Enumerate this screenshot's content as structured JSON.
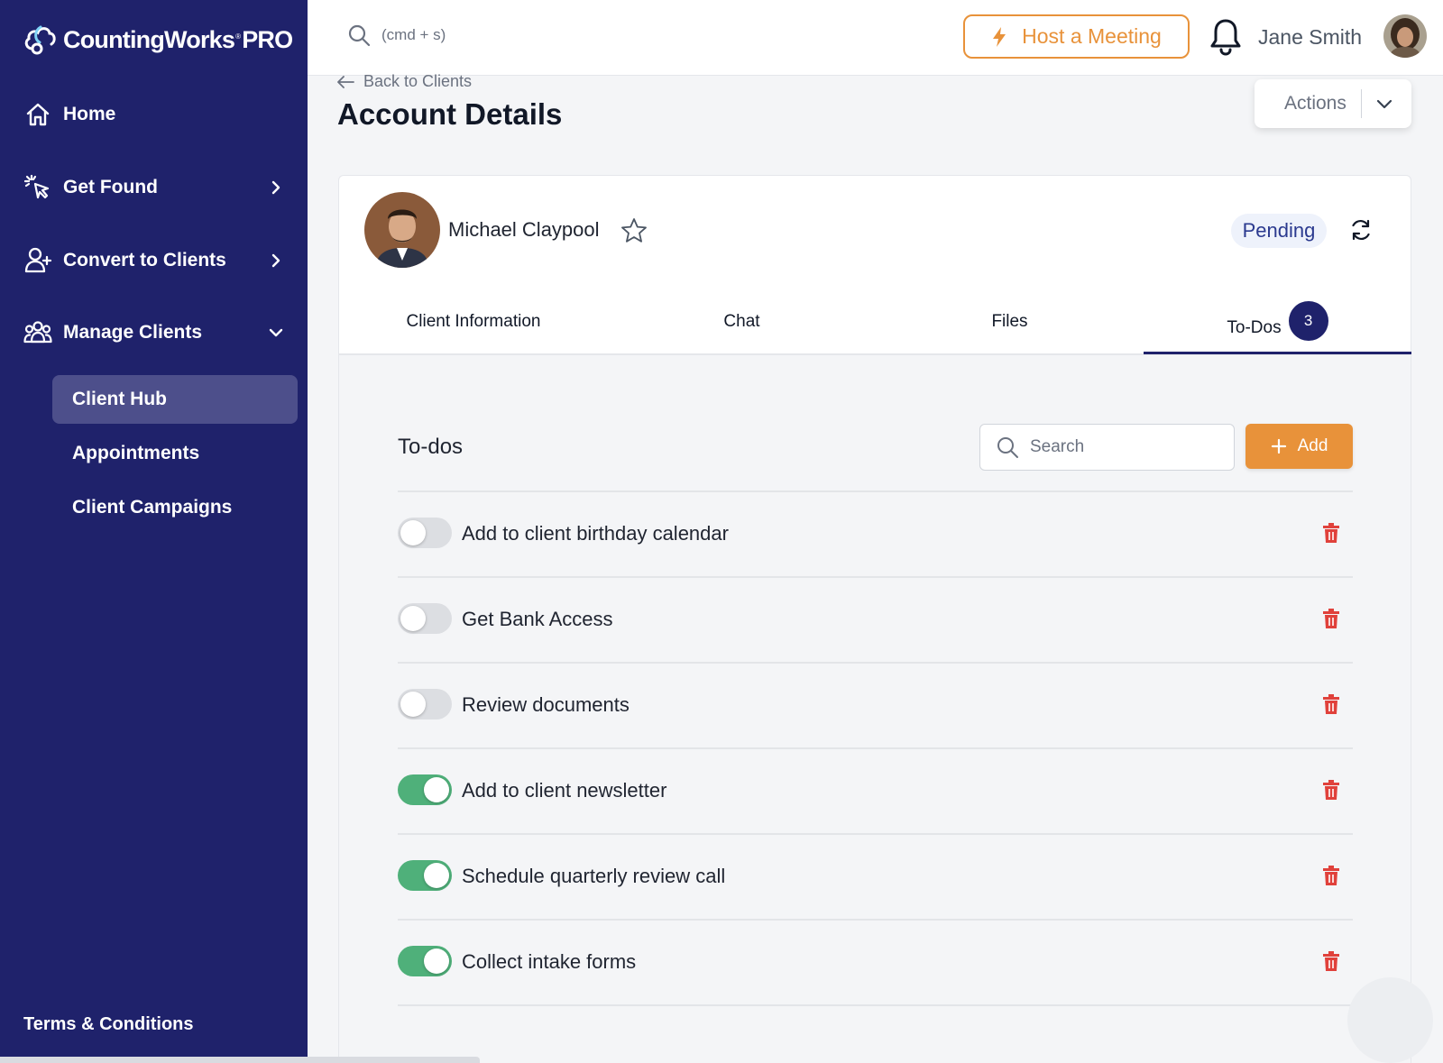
{
  "brand": {
    "name": "CountingWorks",
    "reg": "®",
    "suffix": "PRO"
  },
  "sidebar": {
    "nav": [
      {
        "label": "Home",
        "icon": "home-icon"
      },
      {
        "label": "Get Found",
        "icon": "pointer-click-icon"
      },
      {
        "label": "Convert to Clients",
        "icon": "user-plus-icon"
      },
      {
        "label": "Manage Clients",
        "icon": "users-group-icon"
      }
    ],
    "subnav": [
      {
        "label": "Client Hub",
        "active": true
      },
      {
        "label": "Appointments",
        "active": false
      },
      {
        "label": "Client Campaigns",
        "active": false
      }
    ],
    "footer_link": "Terms & Conditions"
  },
  "topbar": {
    "search_placeholder": "(cmd + s)",
    "host_meeting_label": "Host a Meeting",
    "user_name": "Jane Smith"
  },
  "page": {
    "back_label": "Back to Clients",
    "title": "Account Details",
    "actions_label": "Actions"
  },
  "client": {
    "name": "Michael Claypool",
    "status": "Pending"
  },
  "tabs": [
    {
      "label": "Client Information",
      "active": false
    },
    {
      "label": "Chat",
      "active": false
    },
    {
      "label": "Files",
      "active": false
    },
    {
      "label": "To-Dos",
      "active": true,
      "badge": "3"
    }
  ],
  "todos": {
    "title": "To-dos",
    "search_placeholder": "Search",
    "add_label": "Add",
    "items": [
      {
        "label": "Add to client birthday calendar",
        "done": false
      },
      {
        "label": "Get Bank Access",
        "done": false
      },
      {
        "label": "Review documents",
        "done": false
      },
      {
        "label": "Add to client newsletter",
        "done": true
      },
      {
        "label": "Schedule quarterly review call",
        "done": true
      },
      {
        "label": "Collect intake forms",
        "done": true
      }
    ]
  },
  "colors": {
    "sidebar_bg": "#1f226b",
    "accent_orange": "#e8923a",
    "toggle_on": "#4fb07a",
    "danger": "#e0413b",
    "status_pill_bg": "#eef2fb"
  }
}
